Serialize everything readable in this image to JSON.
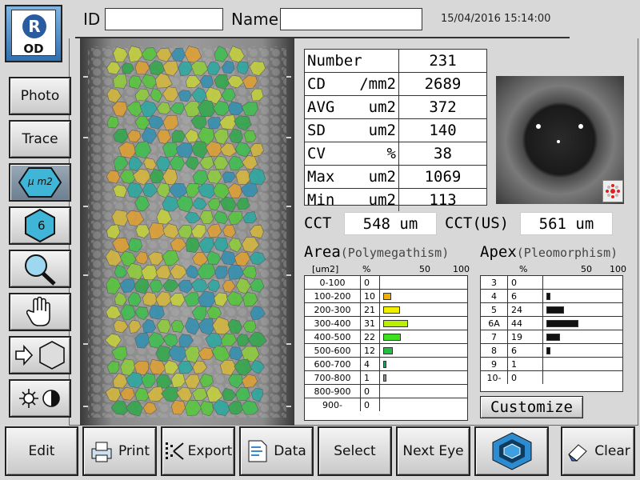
{
  "eye": {
    "letter": "R",
    "label": "OD"
  },
  "header": {
    "id_label": "ID",
    "id_value": "",
    "name_label": "Name",
    "name_value": "",
    "datetime": "15/04/2016 15:14:00"
  },
  "sidebar": [
    {
      "name": "photo-button",
      "label": "Photo",
      "icon": ""
    },
    {
      "name": "trace-button",
      "label": "Trace",
      "icon": ""
    },
    {
      "name": "area-mode-button",
      "label": "μ m2",
      "icon": "hexagon-um2-icon"
    },
    {
      "name": "apex-mode-button",
      "label": "6",
      "icon": "hexagon-6-icon"
    },
    {
      "name": "zoom-button",
      "label": "",
      "icon": "magnifier-icon"
    },
    {
      "name": "pan-button",
      "label": "",
      "icon": "hand-icon"
    },
    {
      "name": "cell-select-button",
      "label": "",
      "icon": "arrow-hexagon-icon"
    },
    {
      "name": "brightness-contrast-button",
      "label": "",
      "icon": "brightness-contrast-icon"
    }
  ],
  "stats": [
    {
      "label": "Number",
      "unit": "",
      "value": "231"
    },
    {
      "label": "CD",
      "unit": "/mm2",
      "value": "2689"
    },
    {
      "label": "AVG",
      "unit": "um2",
      "value": "372"
    },
    {
      "label": "SD",
      "unit": "um2",
      "value": "140"
    },
    {
      "label": "CV",
      "unit": "%",
      "value": "38"
    },
    {
      "label": "Max",
      "unit": "um2",
      "value": "1069"
    },
    {
      "label": "Min",
      "unit": "um2",
      "value": "113"
    }
  ],
  "cct": {
    "label": "CCT",
    "value": "548 um",
    "us_label": "CCT(US)",
    "us_value": "561 um"
  },
  "area_hist": {
    "title": "Area",
    "subtitle": "(Polymegathism)",
    "unit_label": "[um2]",
    "pct_label": "%",
    "tick50": "50",
    "tick100": "100",
    "rows": [
      {
        "label": "0-100",
        "pct": "0",
        "value": 0,
        "color": ""
      },
      {
        "label": "100-200",
        "pct": "10",
        "value": 10,
        "color": "#f0b000"
      },
      {
        "label": "200-300",
        "pct": "21",
        "value": 21,
        "color": "#f0f000"
      },
      {
        "label": "300-400",
        "pct": "31",
        "value": 31,
        "color": "#b8f000"
      },
      {
        "label": "400-500",
        "pct": "22",
        "value": 22,
        "color": "#40e020"
      },
      {
        "label": "500-600",
        "pct": "12",
        "value": 12,
        "color": "#20c040"
      },
      {
        "label": "600-700",
        "pct": "4",
        "value": 4,
        "color": "#20a060"
      },
      {
        "label": "700-800",
        "pct": "1",
        "value": 1,
        "color": ""
      },
      {
        "label": "800-900",
        "pct": "0",
        "value": 0,
        "color": ""
      },
      {
        "label": "900-",
        "pct": "0",
        "value": 0,
        "color": ""
      }
    ]
  },
  "apex_hist": {
    "title": "Apex",
    "subtitle": "(Pleomorphism)",
    "pct_label": "%",
    "tick50": "50",
    "tick100": "100",
    "rows": [
      {
        "label": "3",
        "pct": "0",
        "value": 0
      },
      {
        "label": "4",
        "pct": "6",
        "value": 6
      },
      {
        "label": "5",
        "pct": "24",
        "value": 24
      },
      {
        "label": "6A",
        "pct": "44",
        "value": 44
      },
      {
        "label": "7",
        "pct": "19",
        "value": 19
      },
      {
        "label": "8",
        "pct": "6",
        "value": 6
      },
      {
        "label": "9",
        "pct": "1",
        "value": 0
      },
      {
        "label": "10-",
        "pct": "0",
        "value": 0
      }
    ]
  },
  "customize_label": "Customize",
  "bottom": [
    {
      "name": "edit-button",
      "label": "Edit",
      "icon": ""
    },
    {
      "name": "print-button",
      "label": "Print",
      "icon": "printer-icon"
    },
    {
      "name": "export-button",
      "label": "Export",
      "icon": "export-icon"
    },
    {
      "name": "data-button",
      "label": "Data",
      "icon": "data-icon"
    },
    {
      "name": "select-button",
      "label": "Select",
      "icon": ""
    },
    {
      "name": "next-eye-button",
      "label": "Next Eye",
      "icon": ""
    },
    {
      "name": "analysis-button",
      "label": "",
      "icon": "cell-hexagon-icon"
    },
    {
      "name": "clear-button",
      "label": "Clear",
      "icon": "eraser-icon"
    }
  ]
}
